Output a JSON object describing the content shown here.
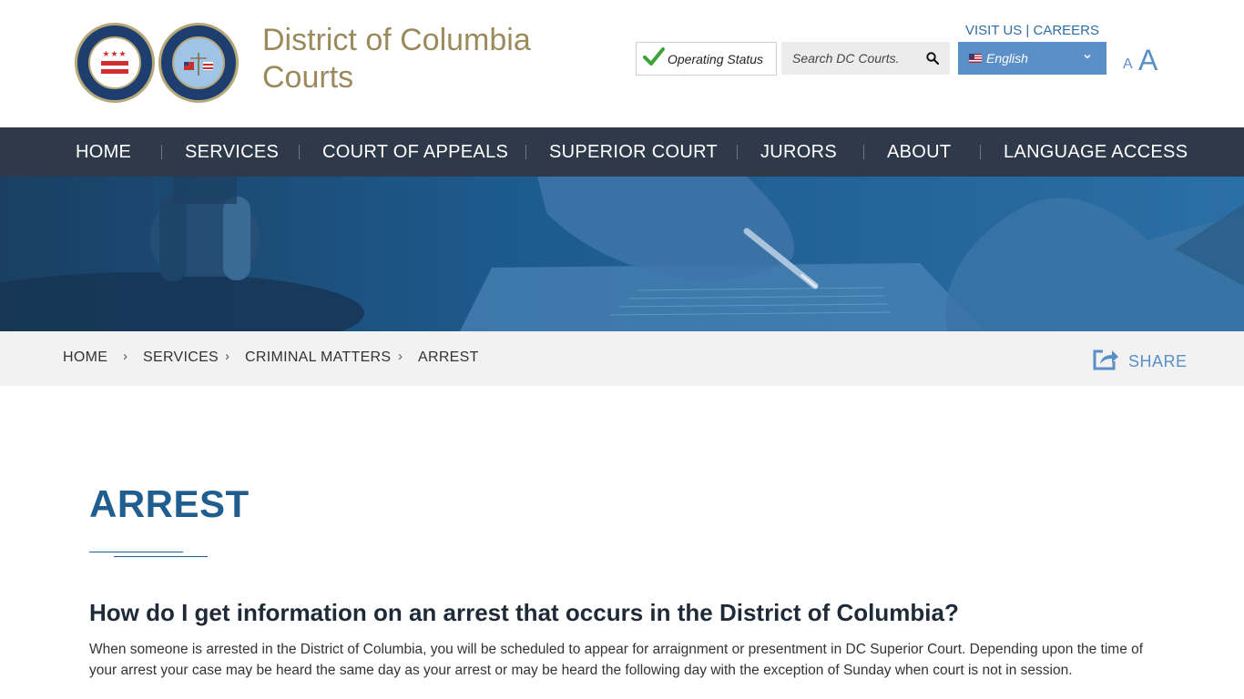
{
  "header": {
    "site_title_line1": "District of Columbia",
    "site_title_line2": "Courts",
    "top_links": {
      "visit_us": "VISIT US",
      "separator": "|",
      "careers": "CAREERS"
    },
    "operating_status": "Operating Status",
    "search": {
      "placeholder": "Search DC Courts."
    },
    "language": {
      "selected": "English"
    },
    "font_size": {
      "small": "A",
      "large": "A"
    },
    "seals": [
      "district-of-columbia-court-of-appeals-seal",
      "superior-court-district-of-columbia-seal"
    ]
  },
  "nav": {
    "items": [
      {
        "label": "HOME"
      },
      {
        "label": "SERVICES"
      },
      {
        "label": "COURT OF APPEALS"
      },
      {
        "label": "SUPERIOR COURT"
      },
      {
        "label": "JURORS"
      },
      {
        "label": "ABOUT"
      },
      {
        "label": "LANGUAGE ACCESS"
      }
    ]
  },
  "breadcrumb": {
    "items": [
      {
        "label": "HOME"
      },
      {
        "label": "SERVICES"
      },
      {
        "label": "CRIMINAL MATTERS"
      },
      {
        "label": "ARREST"
      }
    ],
    "separator": "›",
    "share_label": "SHARE"
  },
  "content": {
    "title": "ARREST",
    "question": "How do I get information on an arrest that occurs in the District of Columbia?",
    "paragraph": "When someone is arrested in the District of Columbia, you will be scheduled to appear for arraignment or presentment in DC Superior Court. Depending upon the time of your arrest your case may be heard the same day as your arrest or may be heard the following day with the exception of Sunday when court is not in session."
  },
  "colors": {
    "title_gold": "#9b8a5c",
    "nav_bg": "#2e3a4a",
    "accent_blue": "#5b8fc7",
    "heading_blue": "#1f5e8f",
    "hero_blue": "#1d5c8f",
    "check_green": "#3aa535"
  },
  "icons": {
    "status": "checkmark-icon",
    "search": "search-icon",
    "dropdown": "chevron-down-icon",
    "share": "share-icon",
    "flag": "us-flag-icon"
  }
}
